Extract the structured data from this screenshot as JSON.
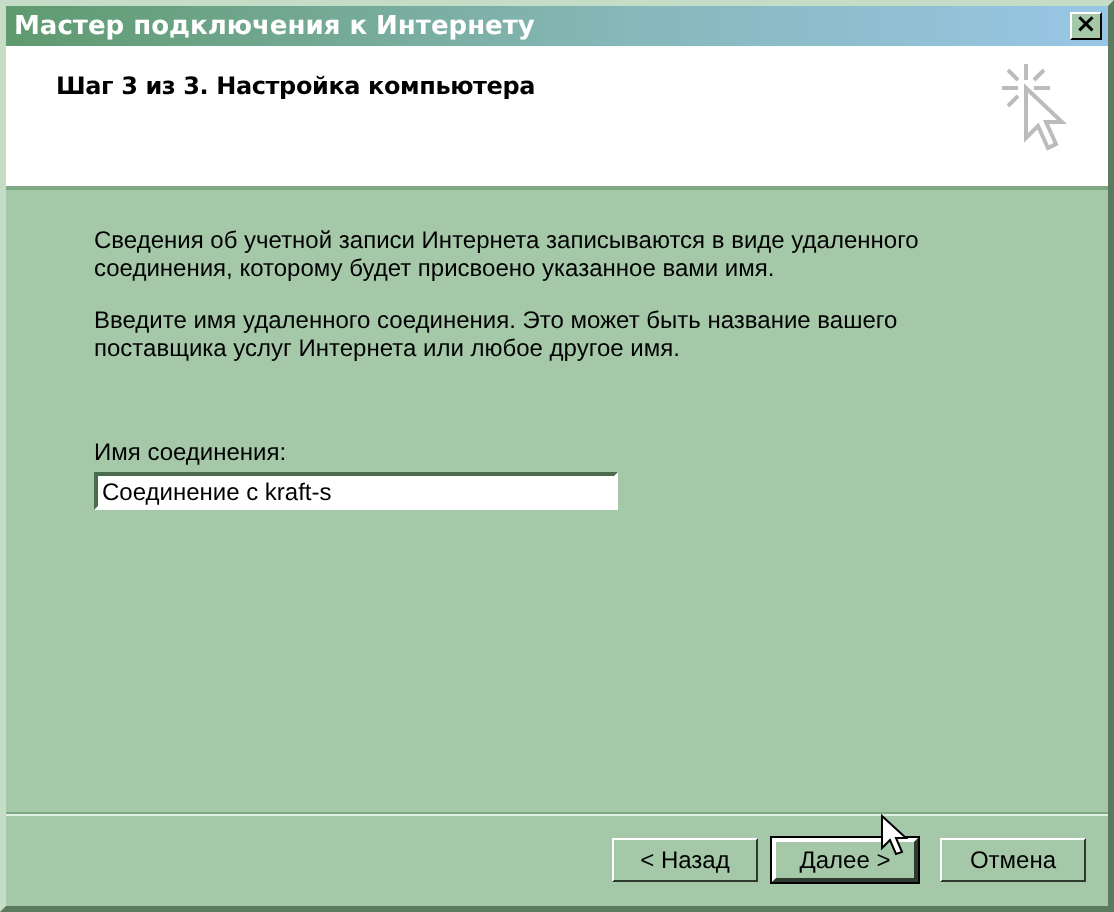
{
  "window": {
    "title": "Мастер подключения к Интернету",
    "close": "×"
  },
  "header": {
    "title": "Шаг 3 из 3. Настройка компьютера"
  },
  "paragraphs": [
    "Сведения об учетной записи Интернета записываются в виде удаленного соединения, которому будет присвоено указанное вами имя.",
    "Введите имя удаленного соединения. Это может быть название вашего поставщика услуг Интернета или любое другое имя."
  ],
  "field": {
    "label": "Имя соединения:",
    "value": "Соединение с kraft-s"
  },
  "buttons": [
    {
      "label": "< Назад",
      "default": false
    },
    {
      "label": "Далее >",
      "default": true
    },
    {
      "label": "Отмена",
      "default": false
    }
  ]
}
